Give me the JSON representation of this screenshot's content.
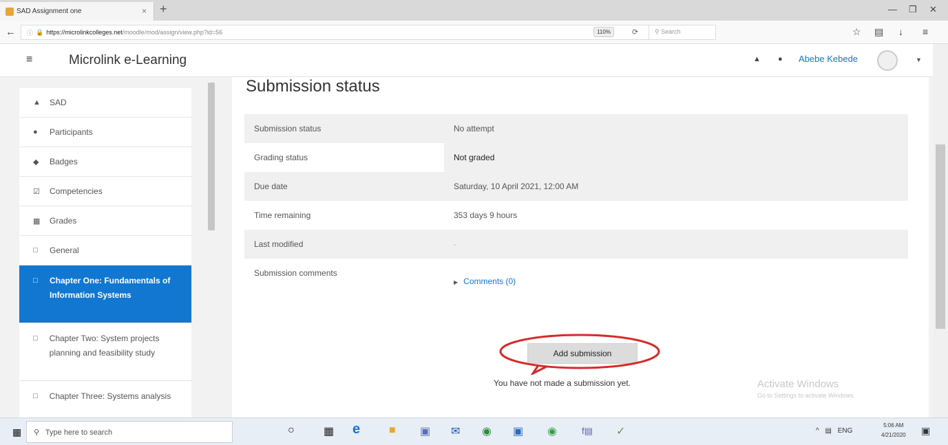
{
  "browser": {
    "tab_title": "SAD Assignment one",
    "tab_close": "×",
    "new_tab": "+",
    "url_host": "https://microlinkcolleges.net",
    "url_path": "/moodle/mod/assign/view.php?id=56",
    "zoom": "110%",
    "search_placeholder": "Search",
    "icons": [
      "back-arrow-icon",
      "lock-icon",
      "reload-icon",
      "search-icon",
      "bookmark-star-icon",
      "library-icon",
      "download-icon",
      "menu-icon"
    ]
  },
  "header": {
    "site_name": "Microlink e-Learning",
    "user_name": "Abebe Kebede"
  },
  "sidebar": {
    "items": [
      {
        "label": "SAD",
        "icon": "graduation-cap-icon"
      },
      {
        "label": "Participants",
        "icon": "users-icon"
      },
      {
        "label": "Badges",
        "icon": "shield-icon"
      },
      {
        "label": "Competencies",
        "icon": "checklist-icon"
      },
      {
        "label": "Grades",
        "icon": "table-icon"
      },
      {
        "label": "General",
        "icon": "folder-icon"
      },
      {
        "label": "Chapter One: Fundamentals of Information Systems",
        "icon": "folder-icon",
        "active": true
      },
      {
        "label": "Chapter Two: System projects planning and feasibility study",
        "icon": "folder-icon"
      },
      {
        "label": "Chapter Three: Systems analysis",
        "icon": "folder-icon"
      }
    ]
  },
  "main": {
    "title": "Submission status",
    "rows": [
      {
        "label": "Submission status",
        "value": "No attempt"
      },
      {
        "label": "Grading status",
        "value": "Not graded"
      },
      {
        "label": "Due date",
        "value": "Saturday, 10 April 2021, 12:00 AM"
      },
      {
        "label": "Time remaining",
        "value": "353 days 9 hours"
      },
      {
        "label": "Last modified",
        "value": "-"
      },
      {
        "label": "Submission comments",
        "value": "Comments (0)"
      }
    ],
    "add_submission_label": "Add submission",
    "not_submitted_text": "You have not made a submission yet."
  },
  "watermark": {
    "line1": "Activate Windows",
    "line2": "Go to Settings to activate Windows."
  },
  "taskbar": {
    "search_placeholder": "Type here to search",
    "tray_lang": "ENG",
    "time": "5:06 AM",
    "date": "4/21/2020"
  },
  "colors": {
    "accent": "#1177d1",
    "annotation": "#d62a2a"
  }
}
